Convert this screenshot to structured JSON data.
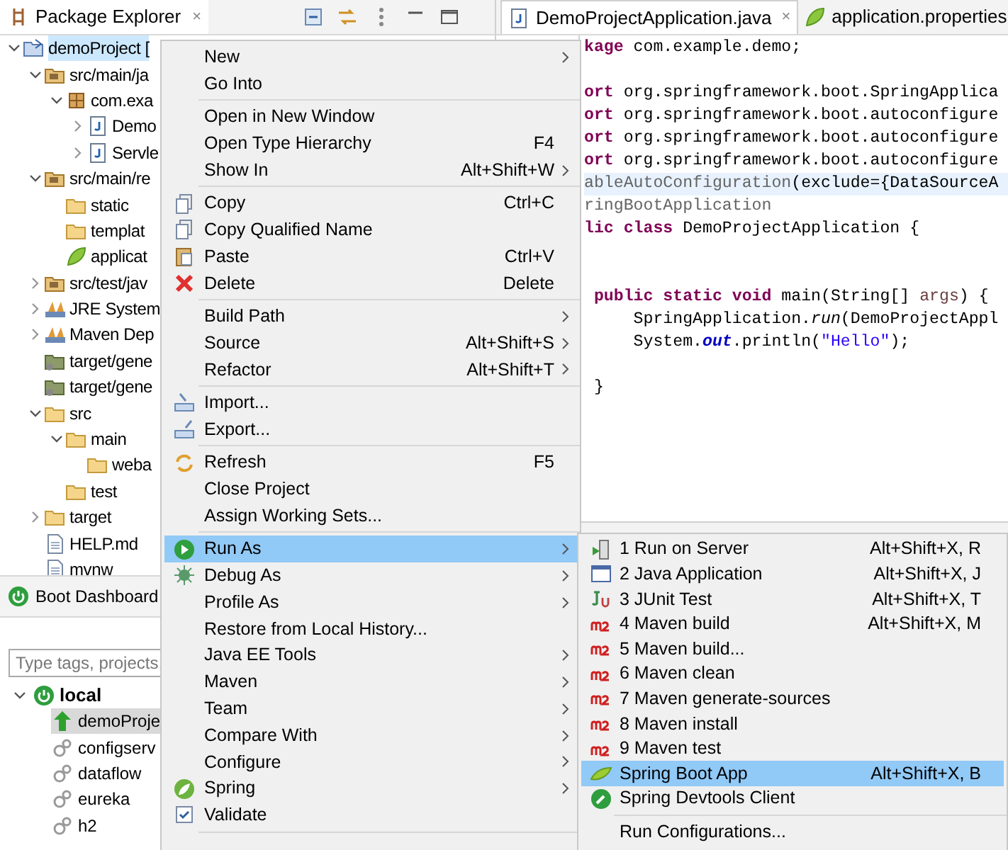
{
  "package_explorer": {
    "title": "Package Explorer",
    "close": "×",
    "tree": [
      {
        "label": "demoProject [",
        "kind": "project",
        "expanded": true,
        "selected": true,
        "children": [
          {
            "label": "src/main/ja",
            "kind": "source",
            "expanded": true,
            "selected": false,
            "children": [
              {
                "label": "com.exa",
                "kind": "package",
                "expanded": true,
                "selected": false,
                "children": [
                  {
                    "label": "Demo",
                    "kind": "java",
                    "expanded": false,
                    "selected": false
                  },
                  {
                    "label": "Servle",
                    "kind": "java",
                    "expanded": false,
                    "selected": false
                  }
                ]
              }
            ]
          },
          {
            "label": "src/main/re",
            "kind": "source",
            "expanded": true,
            "selected": false,
            "children": [
              {
                "label": "static",
                "kind": "folder",
                "selected": false
              },
              {
                "label": "templat",
                "kind": "folder",
                "selected": false
              },
              {
                "label": "applicat",
                "kind": "spring",
                "selected": false
              }
            ]
          },
          {
            "label": "src/test/jav",
            "kind": "source",
            "expanded": false,
            "selected": false
          },
          {
            "label": "JRE System",
            "kind": "library",
            "expanded": false,
            "selected": false
          },
          {
            "label": "Maven Dep",
            "kind": "library",
            "expanded": false,
            "selected": false
          },
          {
            "label": "target/gene",
            "kind": "generated",
            "selected": false
          },
          {
            "label": "target/gene",
            "kind": "generated",
            "selected": false
          },
          {
            "label": "src",
            "kind": "folder",
            "expanded": true,
            "selected": false,
            "children": [
              {
                "label": "main",
                "kind": "folder",
                "expanded": true,
                "selected": false,
                "children": [
                  {
                    "label": "weba",
                    "kind": "folder",
                    "selected": false
                  }
                ]
              },
              {
                "label": "test",
                "kind": "folder",
                "selected": false
              }
            ]
          },
          {
            "label": "target",
            "kind": "folder",
            "expanded": false,
            "selected": false
          },
          {
            "label": "HELP.md",
            "kind": "file",
            "selected": false
          },
          {
            "label": "mvnw",
            "kind": "file",
            "selected": false
          }
        ]
      }
    ]
  },
  "boot_dashboard": {
    "title": "Boot Dashboard",
    "search": {
      "placeholder": "Type tags, projects,"
    },
    "tree": [
      {
        "label": "local",
        "expanded": true,
        "children": [
          {
            "label": "demoProje",
            "kind": "running",
            "selected": true
          },
          {
            "label": "configserv",
            "kind": "stopped",
            "selected": false
          },
          {
            "label": "dataflow",
            "kind": "stopped",
            "selected": false
          },
          {
            "label": "eureka",
            "kind": "stopped",
            "selected": false
          },
          {
            "label": "h2",
            "kind": "stopped",
            "selected": false
          }
        ]
      }
    ]
  },
  "editor": {
    "tabs": [
      {
        "label": "DemoProjectApplication.java",
        "selected": true,
        "close": "×"
      },
      {
        "label": "application.properties",
        "selected": false
      }
    ],
    "lines": [
      {
        "kind": "code",
        "tokens": [
          {
            "kind": "keyword",
            "text": "kage"
          },
          {
            "kind": "plain",
            "text": " com.example.demo;"
          }
        ]
      },
      {
        "kind": "blank"
      },
      {
        "kind": "code",
        "tokens": [
          {
            "kind": "keyword",
            "text": "ort"
          },
          {
            "kind": "plain",
            "text": " org.springframework.boot.SpringApplica"
          }
        ]
      },
      {
        "kind": "code",
        "tokens": [
          {
            "kind": "keyword",
            "text": "ort"
          },
          {
            "kind": "plain",
            "text": " org.springframework.boot.autoconfigure"
          }
        ]
      },
      {
        "kind": "code",
        "tokens": [
          {
            "kind": "keyword",
            "text": "ort"
          },
          {
            "kind": "plain",
            "text": " org.springframework.boot.autoconfigure"
          }
        ]
      },
      {
        "kind": "code",
        "tokens": [
          {
            "kind": "keyword",
            "text": "ort"
          },
          {
            "kind": "plain",
            "text": " org.springframework.boot.autoconfigure"
          }
        ]
      },
      {
        "kind": "code",
        "highlighted": true,
        "tokens": [
          {
            "kind": "annotation",
            "text": "ableAutoConfiguration"
          },
          {
            "kind": "plain",
            "text": "(exclude={DataSourceA"
          }
        ]
      },
      {
        "kind": "code",
        "tokens": [
          {
            "kind": "annotation",
            "text": "ringBootApplication"
          }
        ]
      },
      {
        "kind": "code",
        "tokens": [
          {
            "kind": "keyword",
            "text": "lic"
          },
          {
            "kind": "keyword",
            "text": " class"
          },
          {
            "kind": "plain",
            "text": " DemoProjectApplication {"
          }
        ]
      },
      {
        "kind": "blank"
      },
      {
        "kind": "blank"
      },
      {
        "kind": "code",
        "tokens": [
          {
            "kind": "keyword",
            "text": " public"
          },
          {
            "kind": "keyword",
            "text": " static"
          },
          {
            "kind": "keyword",
            "text": " void"
          },
          {
            "kind": "plain",
            "text": " main(String[] "
          },
          {
            "kind": "parameter",
            "text": "args"
          },
          {
            "kind": "plain",
            "text": ") {"
          }
        ]
      },
      {
        "kind": "code",
        "tokens": [
          {
            "kind": "plain",
            "text": "     SpringApplication."
          },
          {
            "kind": "method",
            "text": "run"
          },
          {
            "kind": "plain",
            "text": "(DemoProjectAppl"
          }
        ]
      },
      {
        "kind": "code",
        "tokens": [
          {
            "kind": "plain",
            "text": "     System."
          },
          {
            "kind": "field",
            "text": "out"
          },
          {
            "kind": "plain",
            "text": ".println("
          },
          {
            "kind": "string",
            "text": "\"Hello\""
          },
          {
            "kind": "plain",
            "text": ");"
          }
        ]
      },
      {
        "kind": "blank"
      },
      {
        "kind": "code",
        "tokens": [
          {
            "kind": "plain",
            "text": " }"
          }
        ]
      }
    ]
  },
  "context_menu": {
    "items": [
      {
        "kind": "item",
        "label": "New",
        "submenu": true,
        "selected": false
      },
      {
        "kind": "item",
        "label": "Go Into",
        "selected": false
      },
      {
        "kind": "separator"
      },
      {
        "kind": "item",
        "label": "Open in New Window",
        "selected": false
      },
      {
        "kind": "item",
        "label": "Open Type Hierarchy",
        "shortcut": "F4",
        "selected": false
      },
      {
        "kind": "item",
        "label": "Show In",
        "shortcut": "Alt+Shift+W",
        "submenu": true,
        "selected": false
      },
      {
        "kind": "separator"
      },
      {
        "kind": "item",
        "label": "Copy",
        "shortcut": "Ctrl+C",
        "selected": false
      },
      {
        "kind": "item",
        "label": "Copy Qualified Name",
        "selected": false
      },
      {
        "kind": "item",
        "label": "Paste",
        "shortcut": "Ctrl+V",
        "selected": false
      },
      {
        "kind": "item",
        "label": "Delete",
        "shortcut": "Delete",
        "selected": false
      },
      {
        "kind": "separator"
      },
      {
        "kind": "item",
        "label": "Build Path",
        "submenu": true,
        "selected": false
      },
      {
        "kind": "item",
        "label": "Source",
        "shortcut": "Alt+Shift+S",
        "submenu": true,
        "selected": false
      },
      {
        "kind": "item",
        "label": "Refactor",
        "shortcut": "Alt+Shift+T",
        "submenu": true,
        "selected": false
      },
      {
        "kind": "separator"
      },
      {
        "kind": "item",
        "label": "Import...",
        "selected": false
      },
      {
        "kind": "item",
        "label": "Export...",
        "selected": false
      },
      {
        "kind": "separator"
      },
      {
        "kind": "item",
        "label": "Refresh",
        "shortcut": "F5",
        "selected": false
      },
      {
        "kind": "item",
        "label": "Close Project",
        "selected": false
      },
      {
        "kind": "item",
        "label": "Assign Working Sets...",
        "selected": false
      },
      {
        "kind": "separator"
      },
      {
        "kind": "item",
        "label": "Run As",
        "submenu": true,
        "selected": true
      },
      {
        "kind": "item",
        "label": "Debug As",
        "submenu": true,
        "selected": false
      },
      {
        "kind": "item",
        "label": "Profile As",
        "submenu": true,
        "selected": false
      },
      {
        "kind": "item",
        "label": "Restore from Local History...",
        "selected": false
      },
      {
        "kind": "item",
        "label": "Java EE Tools",
        "submenu": true,
        "selected": false
      },
      {
        "kind": "item",
        "label": "Maven",
        "submenu": true,
        "selected": false
      },
      {
        "kind": "item",
        "label": "Team",
        "submenu": true,
        "selected": false
      },
      {
        "kind": "item",
        "label": "Compare With",
        "submenu": true,
        "selected": false
      },
      {
        "kind": "item",
        "label": "Configure",
        "submenu": true,
        "selected": false
      },
      {
        "kind": "item",
        "label": "Spring",
        "submenu": true,
        "selected": false
      },
      {
        "kind": "item",
        "label": "Validate",
        "selected": false
      },
      {
        "kind": "separator"
      }
    ]
  },
  "run_as_menu": {
    "items": [
      {
        "kind": "item",
        "label": "1 Run on Server",
        "shortcut": "Alt+Shift+X, R",
        "selected": false
      },
      {
        "kind": "item",
        "label": "2 Java Application",
        "shortcut": "Alt+Shift+X, J",
        "selected": false
      },
      {
        "kind": "item",
        "label": "3 JUnit Test",
        "shortcut": "Alt+Shift+X, T",
        "selected": false
      },
      {
        "kind": "item",
        "label": "4 Maven build",
        "shortcut": "Alt+Shift+X, M",
        "selected": false
      },
      {
        "kind": "item",
        "label": "5 Maven build...",
        "selected": false
      },
      {
        "kind": "item",
        "label": "6 Maven clean",
        "selected": false
      },
      {
        "kind": "item",
        "label": "7 Maven generate-sources",
        "selected": false
      },
      {
        "kind": "item",
        "label": "8 Maven install",
        "selected": false
      },
      {
        "kind": "item",
        "label": "9 Maven test",
        "selected": false
      },
      {
        "kind": "item",
        "label": "Spring Boot App",
        "shortcut": "Alt+Shift+X, B",
        "selected": true
      },
      {
        "kind": "item",
        "label": "Spring Devtools Client",
        "selected": false
      },
      {
        "kind": "separator"
      },
      {
        "kind": "item",
        "label": "Run Configurations...",
        "selected": false
      }
    ]
  }
}
